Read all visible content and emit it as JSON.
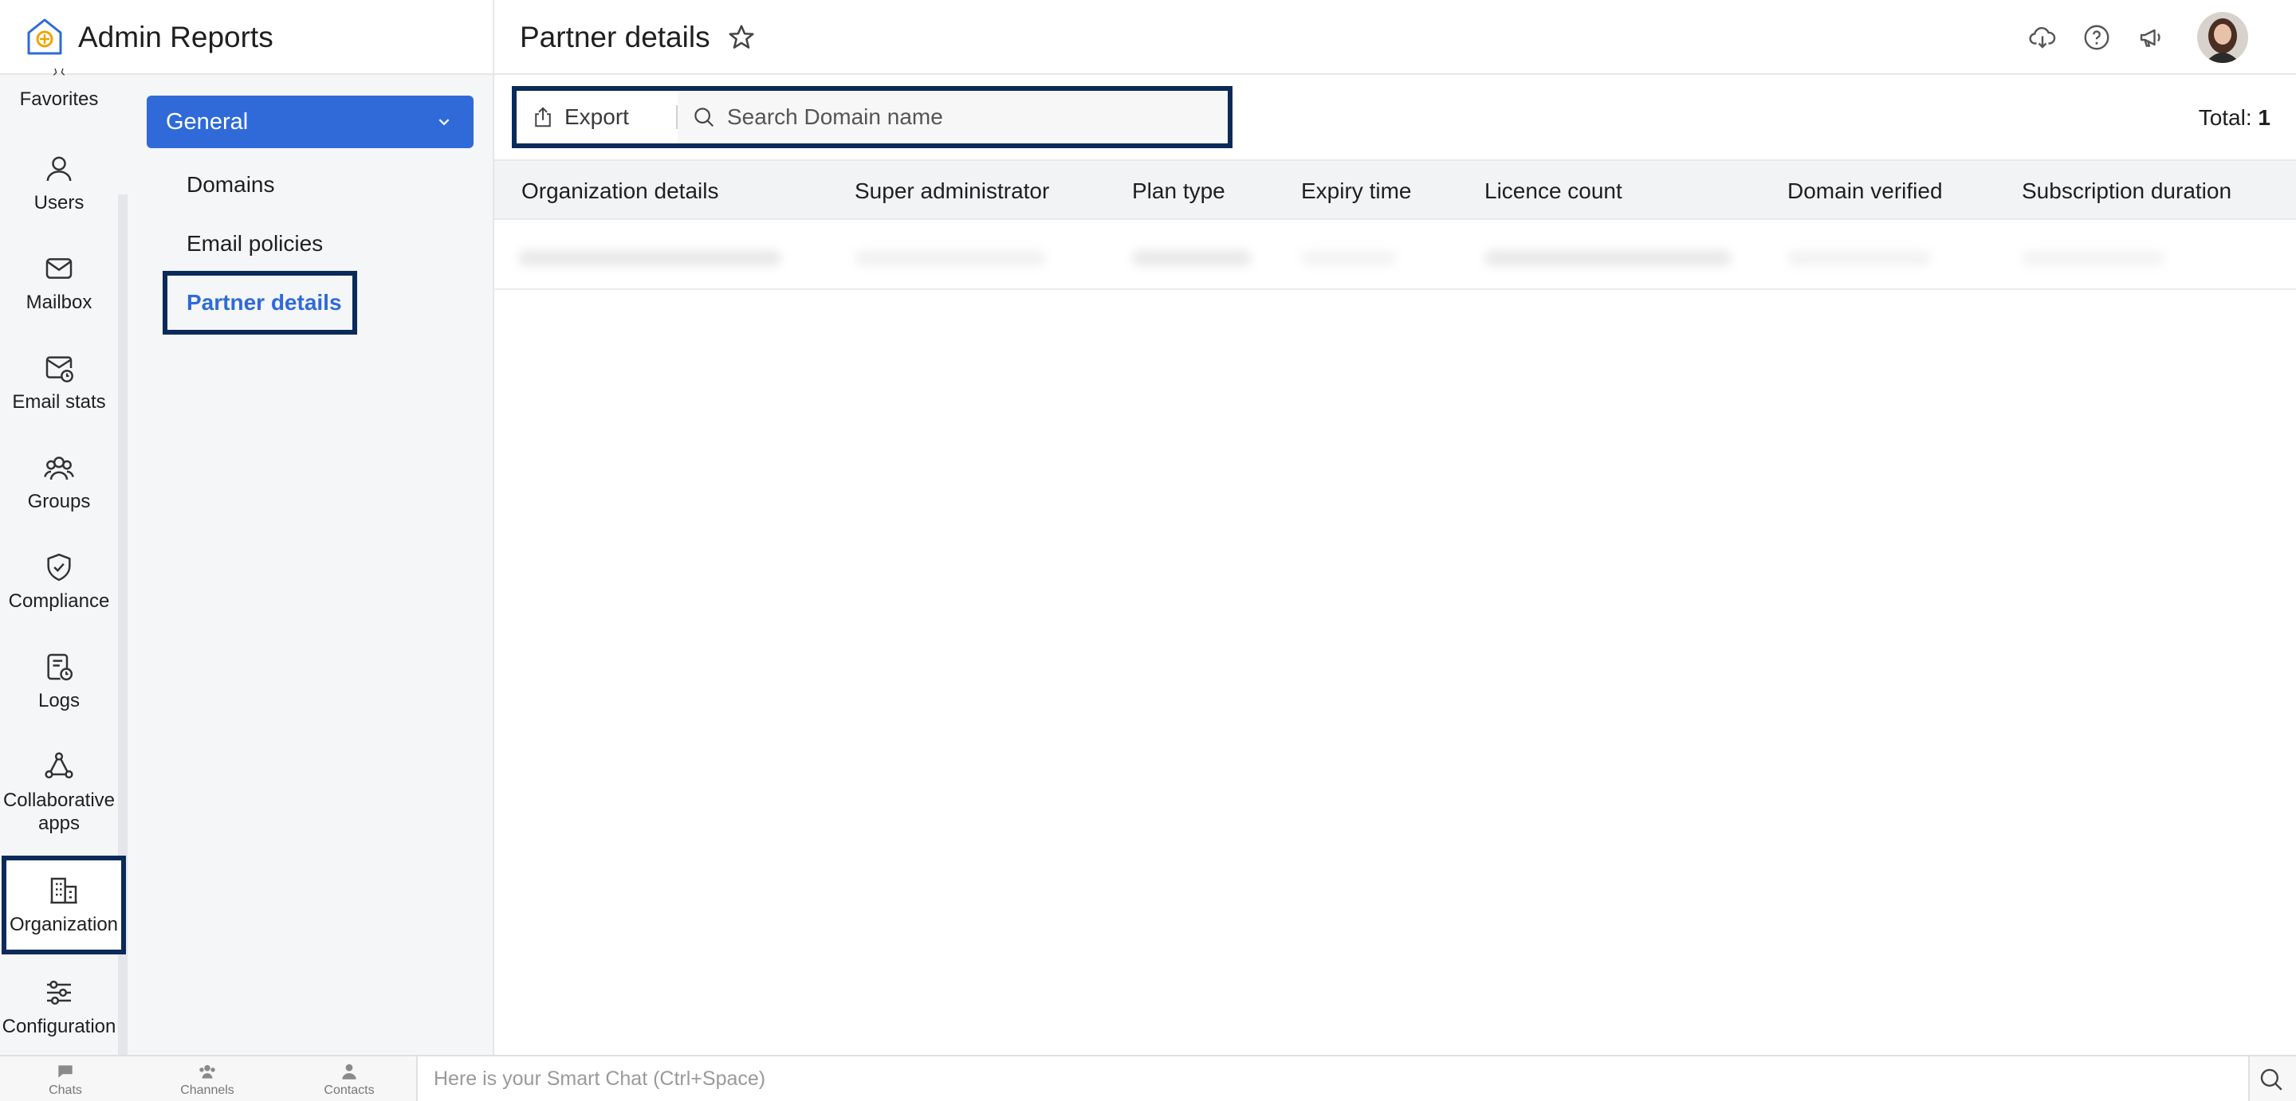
{
  "app": {
    "title": "Admin Reports"
  },
  "header": {
    "page_title": "Partner details"
  },
  "rail": {
    "items": [
      {
        "label": "Favorites"
      },
      {
        "label": "Users"
      },
      {
        "label": "Mailbox"
      },
      {
        "label": "Email stats"
      },
      {
        "label": "Groups"
      },
      {
        "label": "Compliance"
      },
      {
        "label": "Logs"
      },
      {
        "label": "Collaborative apps"
      },
      {
        "label": "Organization"
      },
      {
        "label": "Configuration"
      }
    ],
    "active": "Organization"
  },
  "subnav": {
    "group_label": "General",
    "items": [
      {
        "label": "Domains"
      },
      {
        "label": "Email policies"
      },
      {
        "label": "Partner details"
      }
    ],
    "active": "Partner details"
  },
  "toolbar": {
    "export_label": "Export",
    "search_placeholder": "Search Domain name",
    "total_label": "Total:",
    "total_value": "1"
  },
  "table": {
    "columns": [
      "Organization details",
      "Super administrator",
      "Plan type",
      "Expiry time",
      "Licence count",
      "Domain verified",
      "Subscription duration"
    ]
  },
  "bottombar": {
    "tabs": [
      {
        "label": "Chats"
      },
      {
        "label": "Channels"
      },
      {
        "label": "Contacts"
      }
    ],
    "smartchat_placeholder": "Here is your Smart Chat (Ctrl+Space)"
  },
  "colors": {
    "accent": "#2f6ad8",
    "highlight_border": "#0a2a5a",
    "rail_bg": "#f5f6f8"
  }
}
